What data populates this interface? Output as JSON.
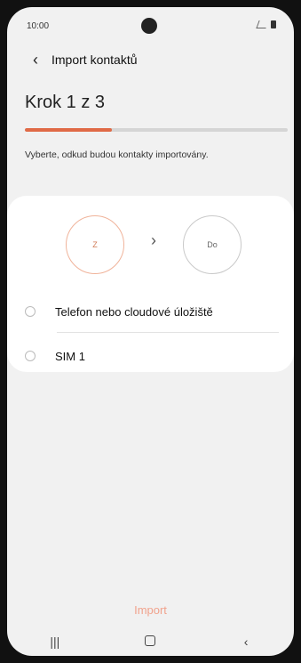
{
  "status_bar": {
    "time": "10:00"
  },
  "header": {
    "title": "Import kontaktů"
  },
  "wizard": {
    "step_label": "Krok 1 z 3",
    "progress": 0.33,
    "hint": "Vyberte, odkud budou kontakty importovány."
  },
  "card": {
    "from_label": "Z",
    "to_label": "Do",
    "options": [
      {
        "label": "Telefon nebo cloudové úložiště"
      },
      {
        "label": "SIM 1"
      }
    ]
  },
  "footer": {
    "import_label": "Import"
  },
  "icons": {
    "back": "chevron-left-icon",
    "arrow": "chevron-right-icon",
    "nav_recent": "recent-apps-icon",
    "nav_home": "home-icon",
    "nav_back": "back-icon"
  },
  "colors": {
    "accent": "#e06a46",
    "import_text": "#f1a38d"
  }
}
